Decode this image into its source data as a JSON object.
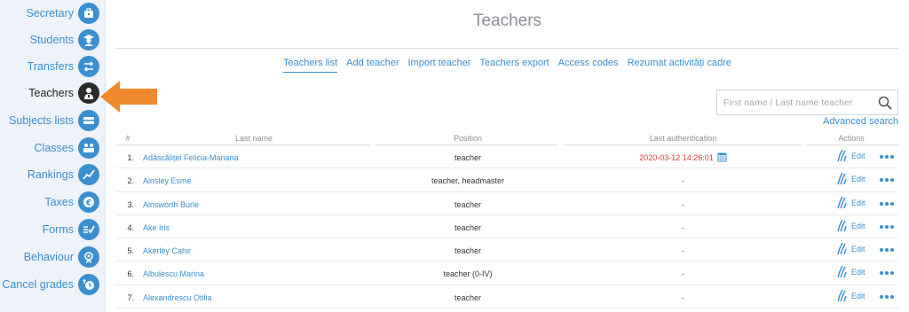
{
  "sidebar": {
    "items": [
      {
        "label": "Secretary",
        "icon": "secretary-icon"
      },
      {
        "label": "Students",
        "icon": "student-icon"
      },
      {
        "label": "Transfers",
        "icon": "transfer-icon"
      },
      {
        "label": "Teachers",
        "icon": "teacher-icon",
        "active": true
      },
      {
        "label": "Subjects lists",
        "icon": "subjects-icon"
      },
      {
        "label": "Classes",
        "icon": "classes-icon"
      },
      {
        "label": "Rankings",
        "icon": "rankings-icon"
      },
      {
        "label": "Taxes",
        "icon": "euro-icon"
      },
      {
        "label": "Forms",
        "icon": "forms-icon"
      },
      {
        "label": "Behaviour",
        "icon": "behaviour-icon"
      },
      {
        "label": "Cancel grades",
        "icon": "cancel-grades-icon"
      }
    ]
  },
  "header": {
    "title": "Teachers"
  },
  "tabs": [
    {
      "label": "Teachers list",
      "active": true
    },
    {
      "label": "Add teacher"
    },
    {
      "label": "Import teacher"
    },
    {
      "label": "Teachers export"
    },
    {
      "label": "Access codes"
    },
    {
      "label": "Rezumat activități cadre"
    }
  ],
  "search": {
    "placeholder": "First name / Last name teacher",
    "value": "",
    "advanced_label": "Advanced search"
  },
  "table": {
    "headers": {
      "num": "#",
      "name": "Last name",
      "position": "Position",
      "auth": "Last authentication",
      "actions": "Actions"
    },
    "edit_label": "Edit",
    "rows": [
      {
        "num": "1.",
        "name": "Adăscăliței Felicia-Mariana",
        "position": "teacher",
        "auth": "2020-03-12 14:26:01",
        "auth_highlight": true
      },
      {
        "num": "2.",
        "name": "Ainsley Esme",
        "position": "teacher, headmaster",
        "auth": "-"
      },
      {
        "num": "3.",
        "name": "Ainsworth Burle",
        "position": "teacher",
        "auth": "-"
      },
      {
        "num": "4.",
        "name": "Ake Iris",
        "position": "teacher",
        "auth": "-"
      },
      {
        "num": "5.",
        "name": "Akerley Cahir",
        "position": "teacher",
        "auth": "-"
      },
      {
        "num": "6.",
        "name": "Albulescu Marina",
        "position": "teacher (0-IV)",
        "auth": "-"
      },
      {
        "num": "7.",
        "name": "Alexandrescu Otilia",
        "position": "teacher",
        "auth": "-"
      }
    ]
  },
  "colors": {
    "accent": "#3a8fd0",
    "active_icon": "#2b2b2b",
    "highlight_arrow": "#f08a2c",
    "auth_red": "#e0403a"
  }
}
